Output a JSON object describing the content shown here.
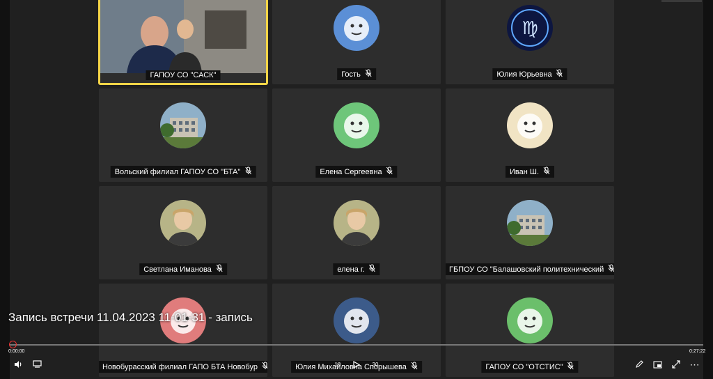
{
  "recording_title": "Запись встречи 11.04.2023 11-01-31 - запись",
  "time_current": "0:00:00",
  "time_total": "0:27:22",
  "accent_color": "#f5d547",
  "progress_fraction": 0.0,
  "participants": [
    {
      "name": "ГАПОУ СО \"САСК\"",
      "avatar": "video",
      "muted": false,
      "active": true
    },
    {
      "name": "Гость",
      "avatar": "monkey-icon",
      "muted": true,
      "color": "#5b8fd6"
    },
    {
      "name": "Юлия Юрьевна",
      "avatar": "virgo-icon",
      "muted": true,
      "color": "#1b2a6b"
    },
    {
      "name": "Вольский филиал ГАПОУ СО \"БТА\"",
      "avatar": "building-photo",
      "muted": true
    },
    {
      "name": "Елена Сергеевна",
      "avatar": "dolphin-icon",
      "muted": true,
      "color": "#6ec67a"
    },
    {
      "name": "Иван Ш.",
      "avatar": "frog-icon",
      "muted": true,
      "color": "#f1e4c4"
    },
    {
      "name": "Светлана Иманова",
      "avatar": "woman-photo",
      "muted": true
    },
    {
      "name": "елена г.",
      "avatar": "woman-photo-2",
      "muted": true
    },
    {
      "name": "ГБПОУ СО \"Балашовский политехнический",
      "avatar": "building-photo-2",
      "muted": true
    },
    {
      "name": "Новобурасский филиал ГАПО БТА Новобур",
      "avatar": "bear-icon",
      "muted": true,
      "color": "#e07c7c"
    },
    {
      "name": "Юлия Михайловна Спорышева",
      "avatar": "frog-icon",
      "muted": true,
      "color": "#3c5b8a"
    },
    {
      "name": "ГАПОУ СО \"ОТСТИС\"",
      "avatar": "lion-icon",
      "muted": true,
      "color": "#6bbf6b"
    }
  ],
  "controls": {
    "volume": "volume-icon",
    "subtitles": "subtitles-icon",
    "rewind_label": "10",
    "play": "play-icon",
    "forward_label": "30",
    "edit": "pencil-icon",
    "pip": "pip-icon",
    "fullscreen": "fullscreen-icon",
    "more": "more-icon"
  }
}
